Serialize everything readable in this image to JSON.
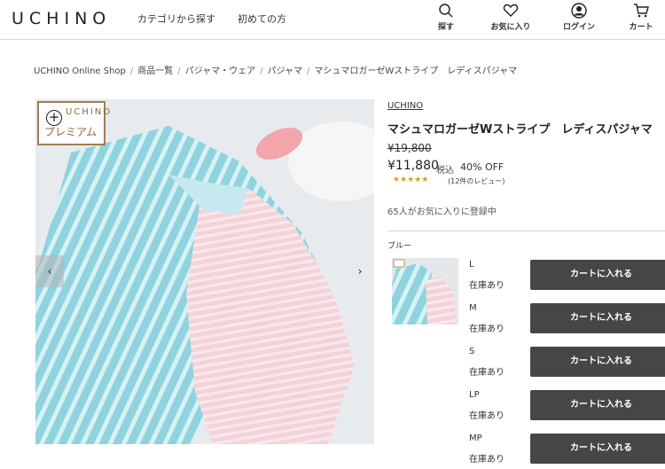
{
  "header": {
    "logo": "UCHINO",
    "nav": [
      "カテゴリから探す",
      "初めての方"
    ],
    "icons": [
      {
        "label": "探す",
        "icon": "search-icon"
      },
      {
        "label": "お気に入り",
        "icon": "heart-icon"
      },
      {
        "label": "ログイン",
        "icon": "user-icon"
      },
      {
        "label": "カート",
        "icon": "cart-icon"
      }
    ]
  },
  "breadcrumb": [
    "UCHINO Online Shop",
    "商品一覧",
    "パジャマ・ウェア",
    "パジャマ",
    "マシュマロガーゼWストライプ　レディスパジャマ"
  ],
  "product": {
    "badge_top": "UCHINO",
    "badge_bottom": "プレミアム",
    "brand": "UCHINO",
    "title": "マシュマロガーゼWストライプ　レディスパジャマ",
    "old_price": "¥19,800",
    "price": "¥11,880",
    "tax_label": "税込",
    "discount": "40% OFF",
    "rating": 4.5,
    "stars": "★★★★★",
    "reviews": "(12件のレビュー)",
    "favorites": "65人がお気に入りに登録中",
    "color_label": "ブルー"
  },
  "sizes": [
    {
      "name": "L",
      "stock": "在庫あり",
      "button": "カートに入れる"
    },
    {
      "name": "M",
      "stock": "在庫あり",
      "button": "カートに入れる"
    },
    {
      "name": "S",
      "stock": "在庫あり",
      "button": "カートに入れる"
    },
    {
      "name": "LP",
      "stock": "在庫あり",
      "button": "カートに入れる"
    },
    {
      "name": "MP",
      "stock": "在庫あり",
      "button": "カートに入れる"
    }
  ],
  "colors": {
    "button": "#464646",
    "stars": "#c9a227",
    "badge_border": "#9c7f4f"
  }
}
